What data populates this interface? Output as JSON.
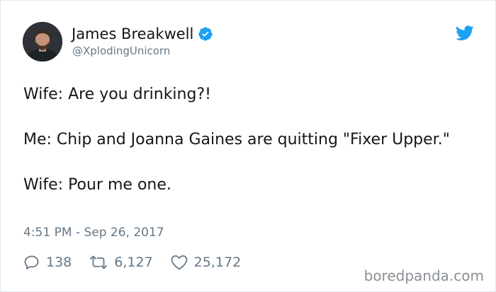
{
  "tweet": {
    "author": {
      "display_name": "James Breakwell",
      "handle": "@XplodingUnicorn",
      "verified": true
    },
    "paragraphs": [
      "Wife: Are you drinking?!",
      "Me: Chip and Joanna Gaines are quitting \"Fixer Upper.\"",
      "Wife: Pour me one."
    ],
    "timestamp": "4:51 PM - Sep 26, 2017",
    "actions": {
      "replies": "138",
      "retweets": "6,127",
      "likes": "25,172"
    }
  },
  "watermark": "boredpanda.com",
  "icons": {
    "verified": "verified-badge-icon",
    "bird": "twitter-bird-icon",
    "reply": "reply-icon",
    "retweet": "retweet-icon",
    "like": "heart-icon"
  },
  "colors": {
    "twitter_blue": "#1da1f2",
    "text": "#14171a",
    "muted": "#657786"
  }
}
